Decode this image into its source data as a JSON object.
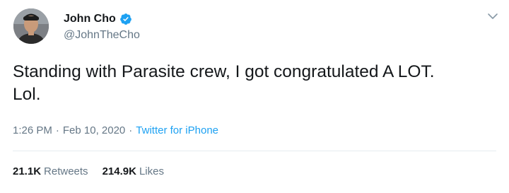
{
  "author": {
    "display_name": "John Cho",
    "handle": "@JohnTheCho",
    "verified": true,
    "avatar_icon": "profile-photo"
  },
  "tweet": {
    "text": "Standing with Parasite crew, I got congratulated A LOT.\nLol.",
    "time": "1:26 PM",
    "date": "Feb 10, 2020",
    "source": "Twitter for iPhone",
    "separator": "·"
  },
  "stats": {
    "retweets_count": "21.1K",
    "retweets_label": "Retweets",
    "likes_count": "214.9K",
    "likes_label": "Likes"
  },
  "icons": {
    "verified": "verified-badge-icon",
    "menu": "chevron-down-icon"
  },
  "colors": {
    "text": "#14171a",
    "secondary": "#657786",
    "accent": "#1da1f2",
    "divider": "#e6ecf0"
  }
}
